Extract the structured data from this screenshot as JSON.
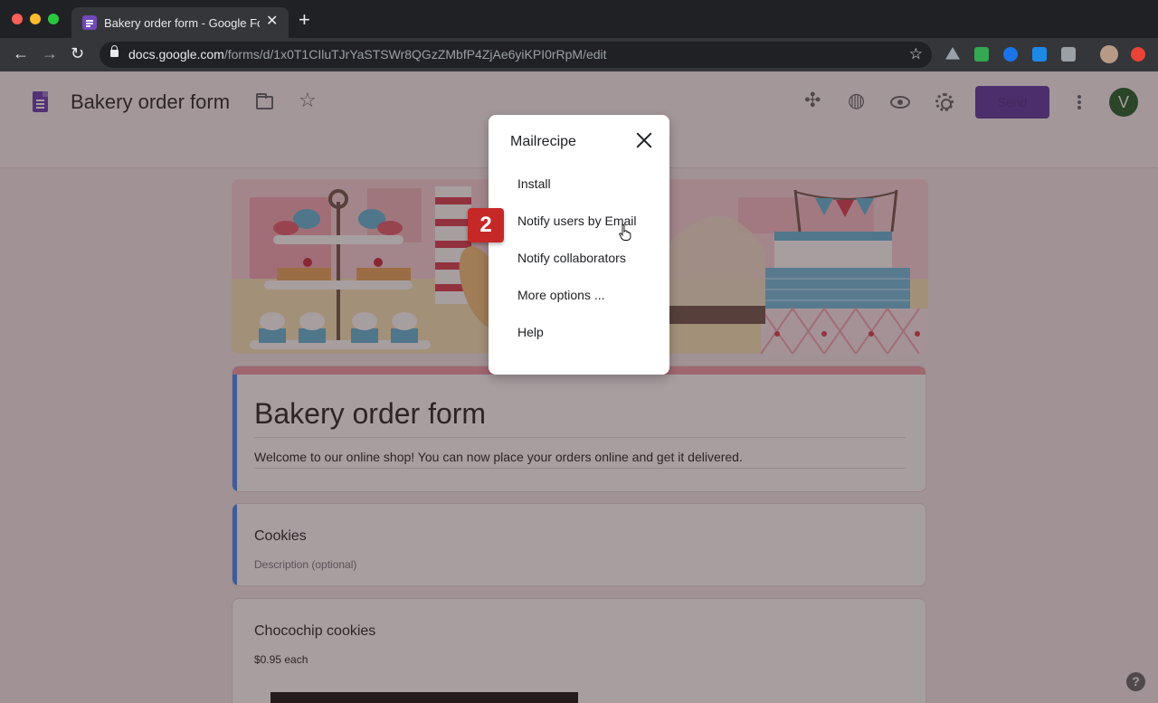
{
  "browser": {
    "tab_title": "Bakery order form - Google Forms",
    "tab_close": "✕",
    "new_tab": "+",
    "url_host": "docs.google.com",
    "url_path": "/forms/d/1x0T1CIluTJrYaSTSWr8QGzZMbfP4ZjAe6yiKPI0rRpM/edit",
    "back": "←",
    "forward": "→",
    "reload": "↻",
    "bookmark": "☆",
    "colors": {
      "close": "#ff5f57",
      "minimize": "#febc2e",
      "maximize": "#28c840"
    }
  },
  "header": {
    "doc_title": "Bakery order form",
    "star_icon": "☆",
    "addons_icon": "✣",
    "palette_icon": "◍",
    "send_label": "Send",
    "avatar_initial": "V"
  },
  "form": {
    "title": "Bakery order form",
    "description": "Welcome to our online shop! You can now place your orders online and get it delivered.",
    "section_title": "Cookies",
    "section_desc": "Description (optional)",
    "item_title": "Chocochip cookies",
    "item_price": "$0.95 each"
  },
  "dialog": {
    "title": "Mailrecipe",
    "items": [
      "Install",
      "Notify users by Email",
      "Notify collaborators",
      "More options ...",
      "Help"
    ]
  },
  "step_badge": "2",
  "help": "?"
}
